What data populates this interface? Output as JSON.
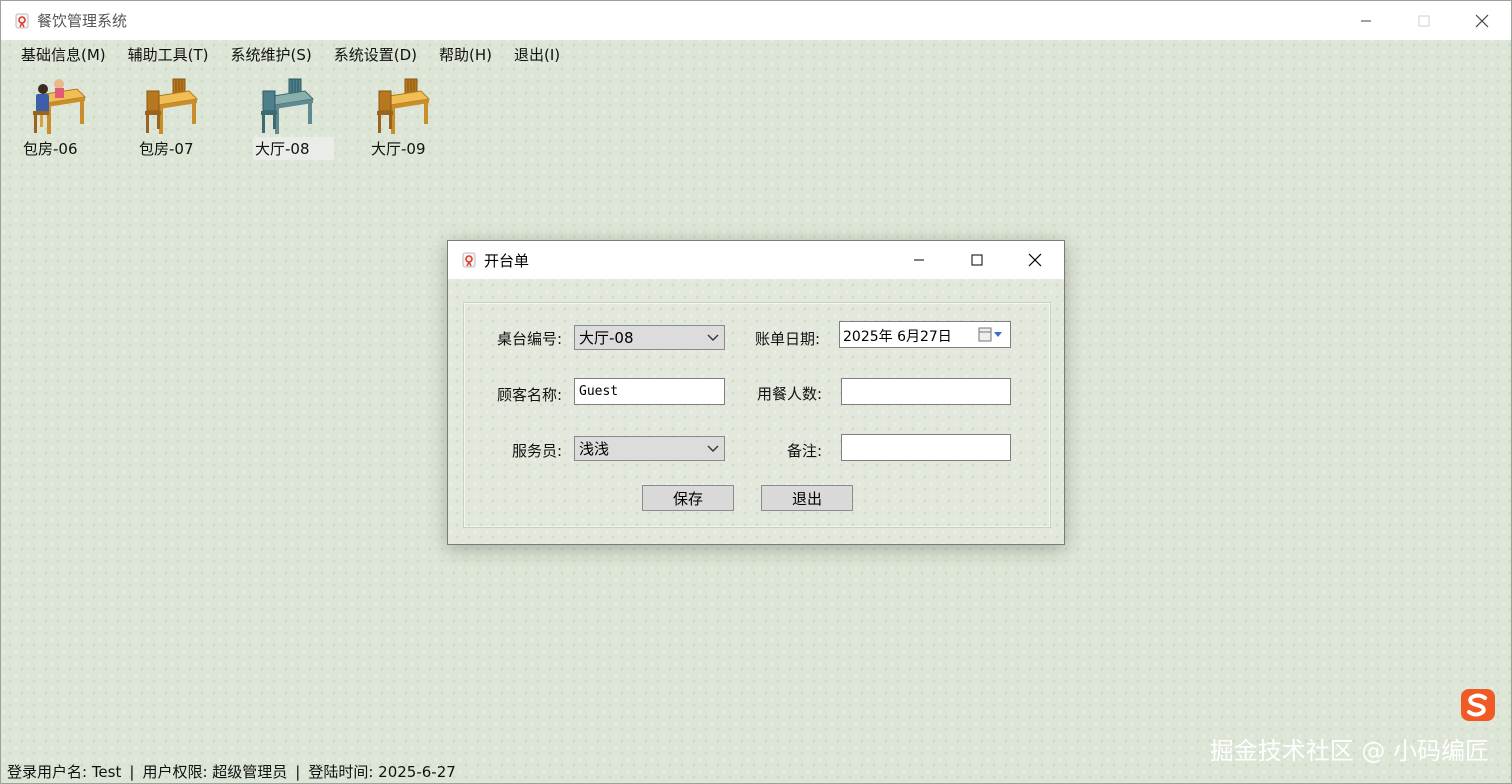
{
  "app": {
    "title": "餐饮管理系统"
  },
  "menu": [
    {
      "label": "基础信息(M)"
    },
    {
      "label": "辅助工具(T)"
    },
    {
      "label": "系统维护(S)"
    },
    {
      "label": "系统设置(D)"
    },
    {
      "label": "帮助(H)"
    },
    {
      "label": "退出(I)"
    }
  ],
  "tables": [
    {
      "label": "包房-06",
      "occupied": true,
      "color": "#e8a93a"
    },
    {
      "label": "包房-07",
      "occupied": false,
      "color": "#e8a93a"
    },
    {
      "label": "大厅-08",
      "occupied": false,
      "color": "#5f8a92",
      "selected": true
    },
    {
      "label": "大厅-09",
      "occupied": false,
      "color": "#e8a93a"
    }
  ],
  "dialog": {
    "title": "开台单",
    "fields": {
      "table_no": {
        "label": "桌台编号:",
        "value": "大厅-08"
      },
      "bill_date": {
        "label": "账单日期:",
        "value": "2025年  6月27日"
      },
      "customer": {
        "label": "顾客名称:",
        "value": "Guest"
      },
      "diners": {
        "label": "用餐人数:",
        "value": ""
      },
      "waiter": {
        "label": "服务员:",
        "value": "浅浅"
      },
      "remark": {
        "label": "备注:",
        "value": ""
      }
    },
    "buttons": {
      "save": "保存",
      "exit": "退出"
    }
  },
  "status": {
    "user": "登录用户名: Test",
    "role": "用户权限: 超级管理员",
    "login_time": "登陆时间: 2025-6-27",
    "sep": "|"
  },
  "watermark": "掘金技术社区 @ 小码编匠",
  "colors": {
    "accent_red": "#e43a2a",
    "table_wood": "#e8a93a",
    "table_blue": "#5f8a92"
  }
}
